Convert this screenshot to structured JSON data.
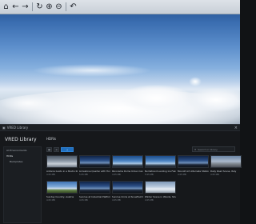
{
  "toolbar": {
    "buttons": [
      {
        "name": "home-button",
        "icon": "home-icon",
        "glyph": "⌂"
      },
      {
        "name": "back-button",
        "icon": "arrow-left-icon",
        "glyph": "←"
      },
      {
        "name": "forward-button",
        "icon": "arrow-right-icon",
        "glyph": "→"
      },
      {
        "name": "refresh-button",
        "icon": "refresh-icon",
        "glyph": "↻"
      },
      {
        "name": "zoom-in-button",
        "icon": "zoom-in-icon",
        "glyph": "⊕"
      },
      {
        "name": "zoom-out-button",
        "icon": "zoom-out-icon",
        "glyph": "⊖"
      },
      {
        "name": "undo-button",
        "icon": "undo-icon",
        "glyph": "↶"
      }
    ]
  },
  "panel": {
    "window_title": "VRED Library",
    "close_glyph": "×",
    "library_heading": "VRED Library",
    "section_heading": "HDRIs",
    "sidebar": [
      {
        "label": "All Environments",
        "selected": false
      },
      {
        "label": "HDRs",
        "selected": true
      },
      {
        "label": "Backplates",
        "selected": false
      }
    ],
    "accent_color": "#1f6fbf",
    "search_placeholder": "Search in library"
  },
  "tiles_row1": [
    {
      "caption": "Antonia Guido in a Studio Kits",
      "sub": "4 05 MB",
      "sky": "studio"
    },
    {
      "caption": "Limestone Quarter with Horizon",
      "sub": "5 05 MB",
      "sky": "dusk"
    },
    {
      "caption": "Panorama Dome Urban Center",
      "sub": "4 05 MB",
      "sky": "clear"
    },
    {
      "caption": "Nordstrand Landing Ice Field",
      "sub": "5 05 MB",
      "sky": "clear"
    },
    {
      "caption": "Moonlit Art Alternate Station",
      "sub": "4 05 MB",
      "sky": "dusk"
    },
    {
      "caption": "Daily Road Scene, Italy",
      "sub": "4 05 MB",
      "sky": "street"
    }
  ],
  "tiles_row2": [
    {
      "caption": "Sunday Country, Austria",
      "sub": "4 05 MB",
      "sky": "field"
    },
    {
      "caption": "Sunrise at Industrial Platform",
      "sub": "4 05 MB",
      "sky": "dusk"
    },
    {
      "caption": "Sunrise Circle at Snowfield River",
      "sub": "4 05 MB",
      "sky": "dusk"
    },
    {
      "caption": "Winter Scene in Woods, Silver",
      "sub": "4 05 MB",
      "sky": "snow"
    }
  ]
}
